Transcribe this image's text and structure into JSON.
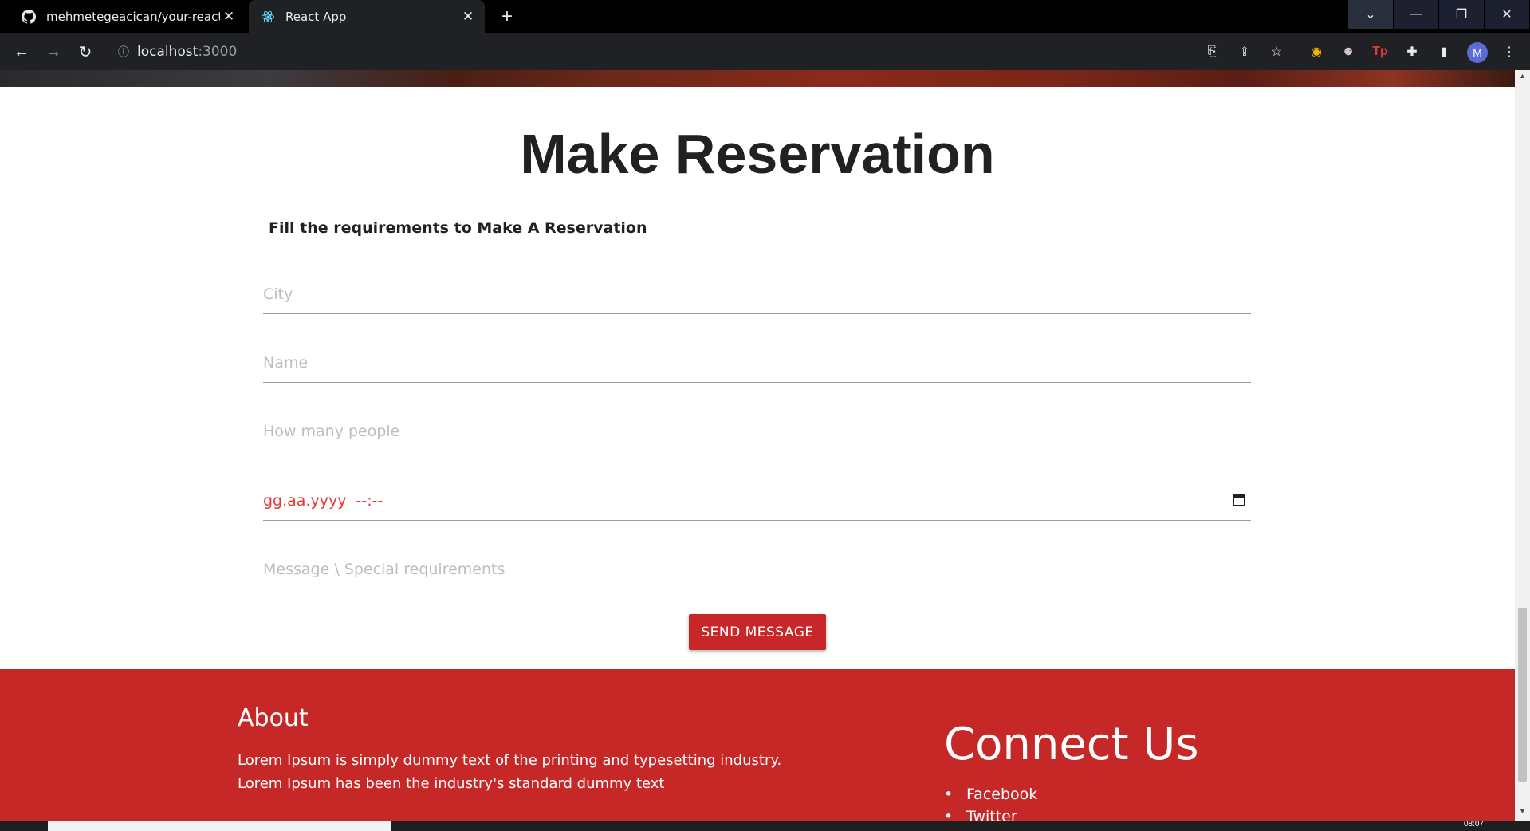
{
  "browser": {
    "tabs": [
      {
        "title": "mehmetegeacican/your-react-re",
        "icon": "github-icon"
      },
      {
        "title": "React App",
        "icon": "react-icon"
      }
    ],
    "url": {
      "host": "localhost",
      "port": ":3000"
    },
    "avatar_letter": "M"
  },
  "reservation": {
    "title": "Make Reservation",
    "subtitle": "Fill the requirements to Make A Reservation",
    "fields": {
      "city_placeholder": "City",
      "name_placeholder": "Name",
      "people_placeholder": "How many people",
      "date_value": "gg.aa.yyyy  --:--",
      "message_placeholder": "Message \\ Special requirements"
    },
    "send_label": "SEND MESSAGE"
  },
  "footer": {
    "about_title": "About",
    "about_text": "Lorem Ipsum is simply dummy text of the printing and typesetting industry. Lorem Ipsum has been the industry's standard dummy text",
    "connect_title": "Connect Us",
    "links": [
      "Facebook",
      "Twitter"
    ]
  },
  "taskbar": {
    "clock": "08:07"
  },
  "colors": {
    "accent": "#c62828",
    "date_text": "#e53935"
  }
}
